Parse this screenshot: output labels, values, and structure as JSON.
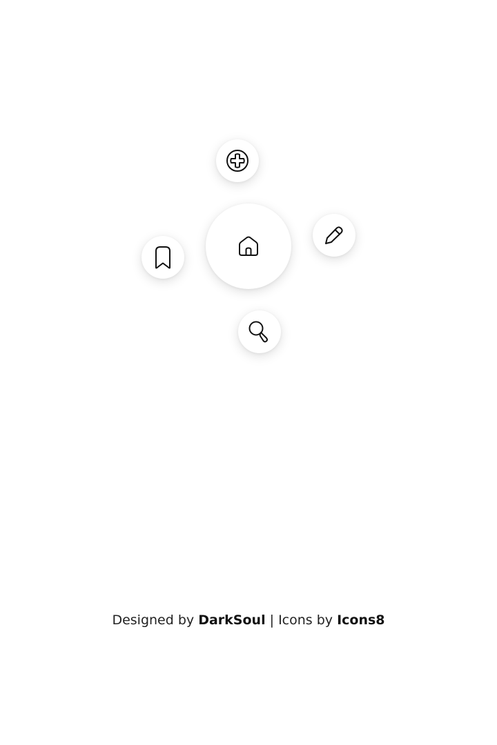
{
  "menu": {
    "center": {
      "icon": "home-icon"
    },
    "items": [
      {
        "icon": "plus-circle-icon"
      },
      {
        "icon": "pencil-icon"
      },
      {
        "icon": "bookmark-icon"
      },
      {
        "icon": "search-icon"
      }
    ]
  },
  "credits": {
    "prefix": "Designed by",
    "designer": "DarkSoul",
    "separator": "| Icons by",
    "icon_source": "Icons8"
  },
  "colors": {
    "background": "#ffffff",
    "button": "#ffffff",
    "icon_stroke": "#111111"
  }
}
